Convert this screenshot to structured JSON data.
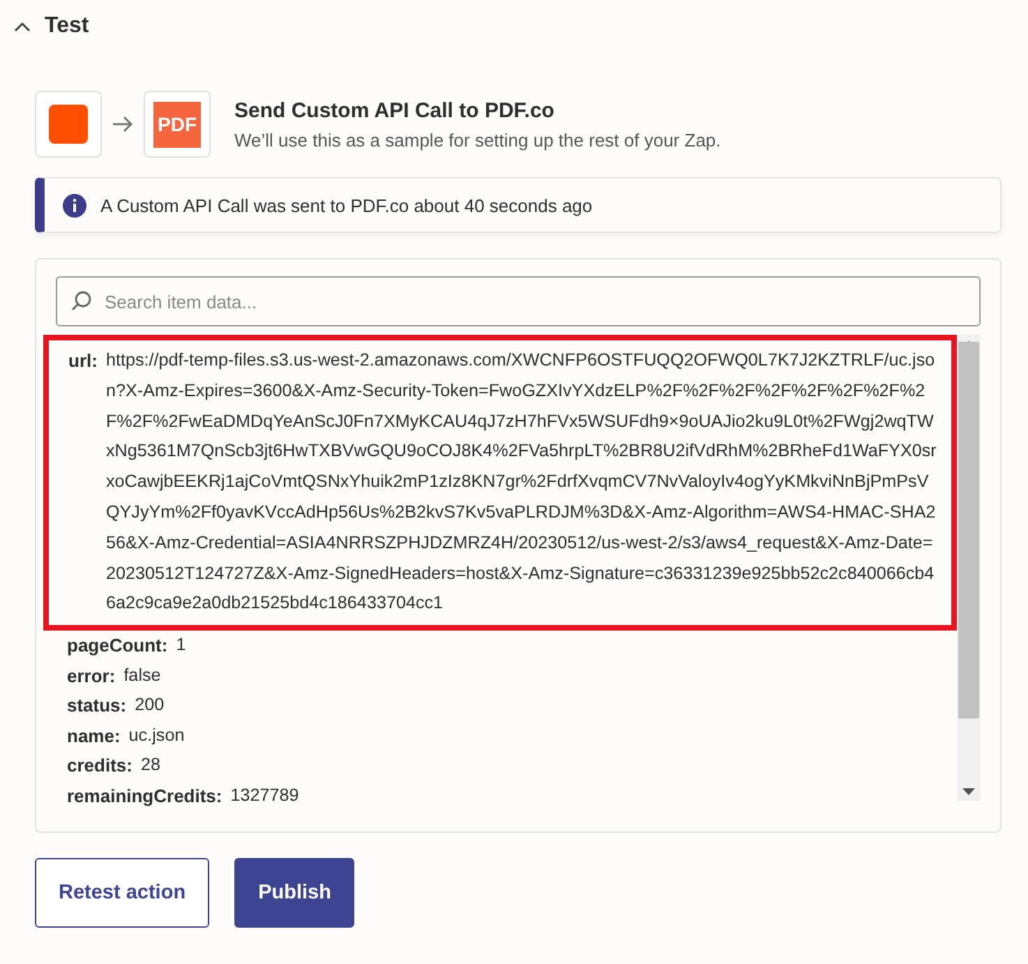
{
  "section": {
    "title": "Test",
    "expanded": true
  },
  "step": {
    "app_logo": "PDF",
    "title": "Send Custom API Call to PDF.co",
    "subtitle": "We’ll use this as a sample for setting up the rest of your Zap."
  },
  "notice": {
    "text": "A Custom API Call was sent to PDF.co about 40 seconds ago"
  },
  "search": {
    "placeholder": "Search item data..."
  },
  "fields": [
    {
      "key": "url:",
      "value": "https://pdf-temp-files.s3.us-west-2.amazonaws.com/XWCNFP6OSTFUQQ2OFWQ0L7K7J2KZTRLF/uc.json?X-Amz-Expires=3600&X-Amz-Security-Token=FwoGZXIvYXdzELP%2F%2F%2F%2F%2F%2F%2F%2F%2F%2FwEaDMDqYeAnScJ0Fn7XMyKCAU4qJ7zH7hFVx5WSUFdh9×9oUAJio2ku9L0t%2FWgj2wqTWxNg5361M7QnScb3jt6HwTXBVwGQU9oCOJ8K4%2FVa5hrpLT%2BR8U2ifVdRhM%2BRheFd1WaFYX0srxoCawjbEEKRj1ajCoVmtQSNxYhuik2mP1zIz8KN7gr%2FdrfXvqmCV7NvValoyIv4ogYyKMkviNnBjPmPsVQYJyYm%2Ff0yavKVccAdHp56Us%2B2kvS7Kv5vaPLRDJM%3D&X-Amz-Algorithm=AWS4-HMAC-SHA256&X-Amz-Credential=ASIA4NRRSZPHJDZMRZ4H/20230512/us-west-2/s3/aws4_request&X-Amz-Date=20230512T124727Z&X-Amz-SignedHeaders=host&X-Amz-Signature=c36331239e925bb52c2c840066cb46a2c9ca9e2a0db21525bd4c186433704cc1",
      "highlighted": true
    },
    {
      "key": "pageCount:",
      "value": "1",
      "highlighted": false
    },
    {
      "key": "error:",
      "value": "false",
      "highlighted": false
    },
    {
      "key": "status:",
      "value": "200",
      "highlighted": false
    },
    {
      "key": "name:",
      "value": "uc.json",
      "highlighted": false
    },
    {
      "key": "credits:",
      "value": "28",
      "highlighted": false
    },
    {
      "key": "remainingCredits:",
      "value": "1327789",
      "highlighted": false
    }
  ],
  "buttons": [
    {
      "label": "Retest action",
      "kind": "secondary"
    },
    {
      "label": "Publish",
      "kind": "primary"
    }
  ]
}
